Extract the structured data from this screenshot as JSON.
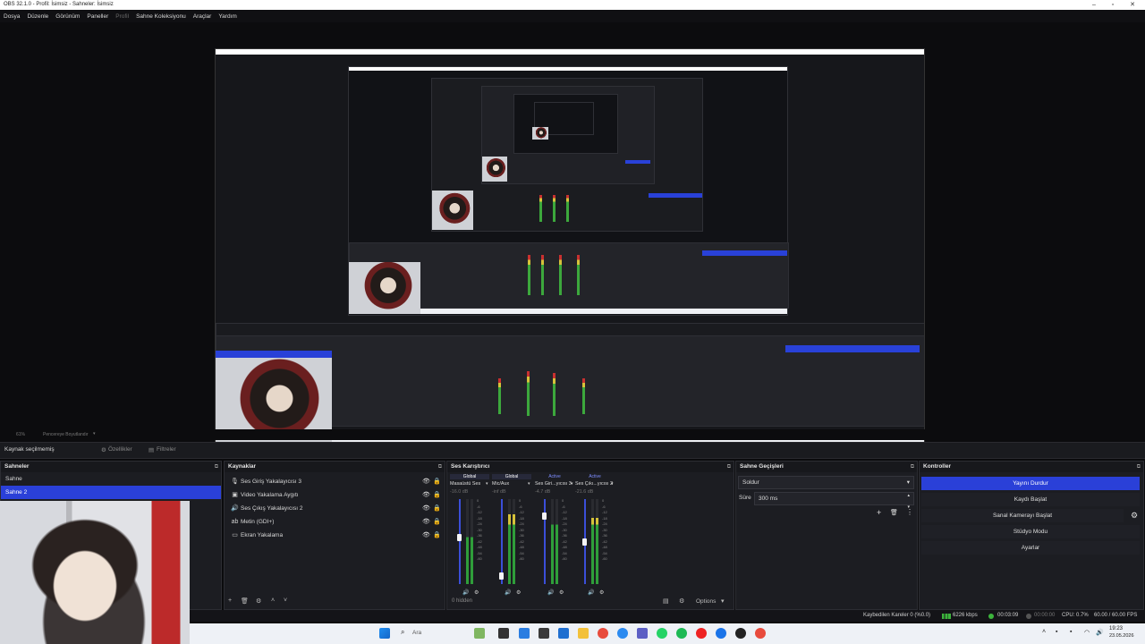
{
  "window": {
    "title": "OBS 32.1.0 - Profil: İsimsiz - Sahneler: İsimsiz"
  },
  "menu": [
    "Dosya",
    "Düzenle",
    "Görünüm",
    "Paneller",
    "Profil",
    "Sahne Koleksiyonu",
    "Araçlar",
    "Yardım"
  ],
  "preview_toolbar": {
    "zoom": "61%",
    "scale_label": "Pencereye Boyutlandır"
  },
  "source_bar": {
    "no_selection": "Kaynak seçilmemiş",
    "properties": "Özellikler",
    "filters": "Filtreler"
  },
  "scenes": {
    "title": "Sahneler",
    "items": [
      "Sahne",
      "Sahne 2"
    ],
    "selected": "Sahne 2"
  },
  "sources": {
    "title": "Kaynaklar",
    "items": [
      {
        "icon": "mic-icon",
        "label": "Ses Giriş Yakalayıcısı 3"
      },
      {
        "icon": "camera-icon",
        "label": "Video Yakalama Aygıtı"
      },
      {
        "icon": "speaker-icon",
        "label": "Ses Çıkış Yakalayıcısı 2"
      },
      {
        "icon": "text-icon",
        "label": "Metin (GDI+)"
      },
      {
        "icon": "monitor-icon",
        "label": "Ekran Yakalama"
      }
    ]
  },
  "mixer": {
    "title": "Ses Karıştırıcı",
    "channels": [
      {
        "tab": "Global",
        "name": "Masaüstü Ses",
        "db": "-16.0 dB",
        "level": 0.55,
        "fader": 0.55
      },
      {
        "tab": "Global",
        "name": "Mic/Aux",
        "db": "-inf dB",
        "level": 0.82,
        "fader": 0.1
      },
      {
        "tab": "Active",
        "name": "Ses Giri...yıcısı 3",
        "db": "-4.7 dB",
        "level": 0.7,
        "fader": 0.8
      },
      {
        "tab": "Active",
        "name": "Ses Çıkı...yıcısı 2",
        "db": "-21.6 dB",
        "level": 0.78,
        "fader": 0.5
      }
    ],
    "ticks": [
      "0",
      "-6",
      "-12",
      "-18",
      "-24",
      "-30",
      "-36",
      "-42",
      "-48",
      "-54",
      "-60"
    ],
    "hidden": "0 hidden",
    "options": "Options"
  },
  "transitions": {
    "title": "Sahne Geçişleri",
    "type": "Soldur",
    "duration_label": "Süre",
    "duration": "300 ms"
  },
  "controls": {
    "title": "Kontroller",
    "buttons": [
      "Yayını Durdur",
      "Kaydı Başlat",
      "Sanal Kamerayı Başlat",
      "Stüdyo Modu",
      "Ayarlar"
    ]
  },
  "status": {
    "dropped": "Kaybedilen Kareler 0 (%0.0)",
    "bitrate": "6226 kbps",
    "stream_time": "00:03:09",
    "rec_time": "00:00:00",
    "cpu": "CPU: 0.7%",
    "fps": "60.00 / 60.00 FPS"
  },
  "taskbar": {
    "search": "Ara",
    "time": "19:23",
    "date": "23.05.2026"
  }
}
